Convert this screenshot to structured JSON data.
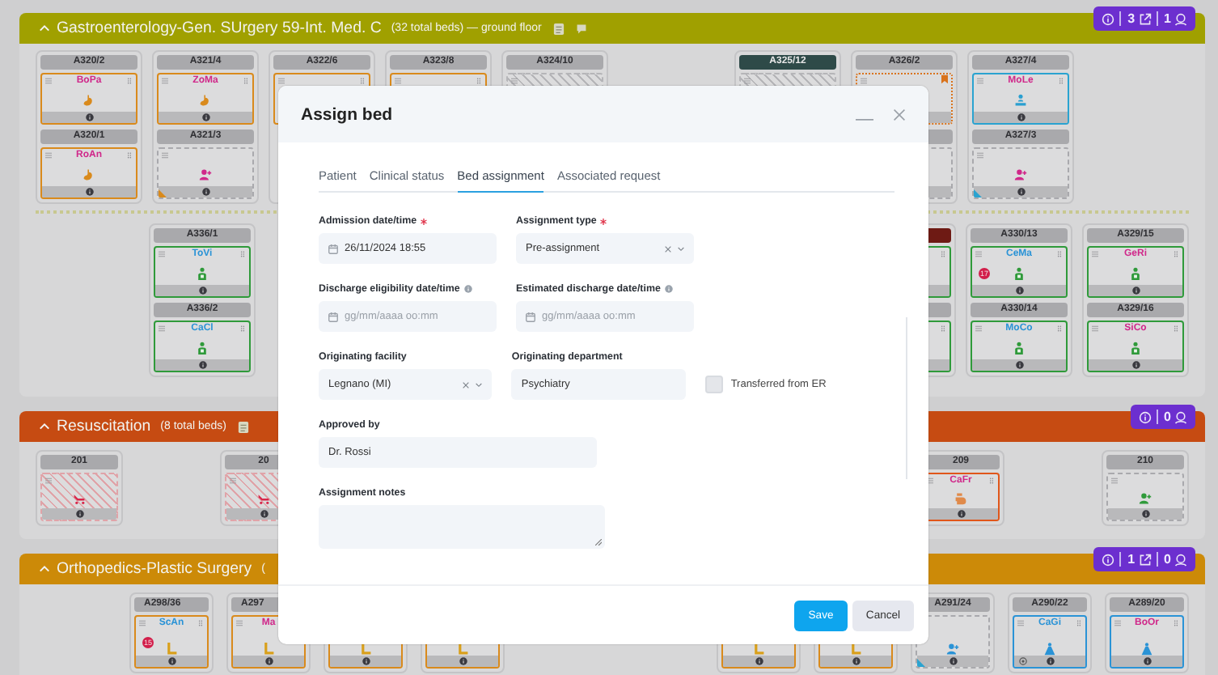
{
  "sections": [
    {
      "kind": "gastro",
      "title": "Gastroenterology-Gen. SUrgery 59-Int. Med. C",
      "subtitle": "(32 total beds) — ground floor",
      "header_icons": [
        {
          "kind": "document"
        },
        {
          "kind": "chat"
        }
      ],
      "counts": [
        {
          "kind": "external",
          "value": "3"
        },
        {
          "kind": "staff",
          "value": "1"
        }
      ],
      "rows": [
        {
          "groups": [
            [
              {
                "beds": [
                  {
                    "label": "A320/2",
                    "kind": "occupied",
                    "color": "#d98a1c",
                    "initials": {
                      "text": "BoPa",
                      "color": "#d0288a"
                    },
                    "icon": {
                      "kind": "stomach",
                      "color": "#d98a1c"
                    }
                  },
                  {
                    "label": "A320/1",
                    "kind": "occupied",
                    "color": "#d98a1c",
                    "initials": {
                      "text": "RoAn",
                      "color": "#d0288a"
                    },
                    "icon": {
                      "kind": "stomach",
                      "color": "#d98a1c"
                    }
                  }
                ]
              },
              {
                "beds": [
                  {
                    "label": "A321/4",
                    "kind": "occupied",
                    "color": "#d98a1c",
                    "initials": {
                      "text": "ZoMa",
                      "color": "#d0288a"
                    },
                    "icon": {
                      "kind": "stomach",
                      "color": "#d98a1c"
                    }
                  },
                  {
                    "label": "A321/3",
                    "kind": "empty",
                    "color": "#a9a9ad",
                    "icon": {
                      "kind": "add-person",
                      "color": "#d0288a"
                    },
                    "corner": {
                      "color": "#d98a1c"
                    }
                  }
                ]
              },
              {
                "beds": [
                  {
                    "label": "A322/6",
                    "kind": "occupied",
                    "color": "#d98a1c"
                  }
                ]
              },
              {
                "beds": [
                  {
                    "label": "A323/8",
                    "kind": "occupied",
                    "color": "#d98a1c"
                  }
                ]
              },
              {
                "beds": [
                  {
                    "label": "A324/10",
                    "kind": "blocked",
                    "color": "#b5b5b8"
                  }
                ]
              }
            ],
            [
              {
                "beds": [
                  {
                    "label": "A325/12",
                    "locked": true,
                    "kind": "blocked",
                    "color": "#b5b5b8"
                  }
                ]
              },
              {
                "beds": [
                  {
                    "label": "A326/2",
                    "kind": "reserved",
                    "color": "#d9731c",
                    "bookmark": true
                  },
                  {
                    "kind": "empty",
                    "color": "#a9a9ad"
                  }
                ]
              },
              {
                "beds": [
                  {
                    "label": "A327/4",
                    "kind": "occupied",
                    "color": "#2aa3d0",
                    "initials": {
                      "text": "MoLe",
                      "color": "#d0288a"
                    },
                    "icon": {
                      "kind": "bed-person",
                      "color": "#2a9fd0"
                    }
                  },
                  {
                    "label": "A327/3",
                    "kind": "empty",
                    "color": "#a9a9ad",
                    "icon": {
                      "kind": "add-person",
                      "color": "#d0288a"
                    },
                    "corner": {
                      "color": "#2aa3d0"
                    }
                  }
                ]
              }
            ]
          ]
        },
        {
          "groups": [
            [
              {
                "beds": [
                  {
                    "label": "A336/1",
                    "kind": "occupied",
                    "color": "#2f9a3a",
                    "initials": {
                      "text": "ToVi",
                      "color": "#2a93d6"
                    },
                    "icon": {
                      "kind": "torso",
                      "color": "#2f9a3a"
                    }
                  },
                  {
                    "label": "A336/2",
                    "kind": "occupied",
                    "color": "#2f9a3a",
                    "initials": {
                      "text": "CaCl",
                      "color": "#2a93d6"
                    },
                    "icon": {
                      "kind": "torso",
                      "color": "#2f9a3a"
                    }
                  }
                ]
              }
            ],
            [
              {
                "beds": [
                  {
                    "alert": true,
                    "kind": "occupied",
                    "color": "#2f9a3a"
                  },
                  {
                    "kind": "occupied",
                    "color": "#2f9a3a"
                  }
                ]
              },
              {
                "beds": [
                  {
                    "label": "A330/13",
                    "kind": "occupied",
                    "color": "#2f9a3a",
                    "initials": {
                      "text": "CeMa",
                      "color": "#2a93d6"
                    },
                    "icon": {
                      "kind": "torso",
                      "color": "#2f9a3a"
                    },
                    "badge": "17"
                  },
                  {
                    "label": "A330/14",
                    "kind": "occupied",
                    "color": "#2f9a3a",
                    "initials": {
                      "text": "MoCo",
                      "color": "#2a93d6"
                    },
                    "icon": {
                      "kind": "torso",
                      "color": "#2f9a3a"
                    }
                  }
                ]
              },
              {
                "beds": [
                  {
                    "label": "A329/15",
                    "kind": "occupied",
                    "color": "#2f9a3a",
                    "initials": {
                      "text": "GeRi",
                      "color": "#d0288a"
                    },
                    "icon": {
                      "kind": "torso",
                      "color": "#2f9a3a"
                    }
                  },
                  {
                    "label": "A329/16",
                    "kind": "occupied",
                    "color": "#2f9a3a",
                    "initials": {
                      "text": "SiCo",
                      "color": "#d0288a"
                    },
                    "icon": {
                      "kind": "torso",
                      "color": "#2f9a3a"
                    }
                  }
                ]
              }
            ]
          ]
        }
      ]
    },
    {
      "kind": "resuscitation",
      "title": "Resuscitation",
      "subtitle": "(8 total beds)",
      "header_icons": [
        {
          "kind": "document"
        }
      ],
      "counts": [
        {
          "kind": "staff",
          "value": "0"
        }
      ],
      "rows": [
        {
          "groups": [
            [
              {
                "beds": [
                  {
                    "label": "201",
                    "kind": "blocked",
                    "color": "#e0a3a8",
                    "icon": {
                      "kind": "stretcher",
                      "color": "#d8264a"
                    }
                  }
                ]
              },
              {
                "beds": [
                  {
                    "label": "20",
                    "kind": "blocked",
                    "color": "#e0a3a8",
                    "icon": {
                      "kind": "stretcher",
                      "color": "#d8264a"
                    }
                  }
                ]
              }
            ],
            [
              {
                "beds": [
                  {
                    "label": "209",
                    "kind": "occupied",
                    "color": "#e0561a",
                    "initials": {
                      "text": "CaFr",
                      "color": "#d0288a"
                    },
                    "icon": {
                      "kind": "hand",
                      "color": "#e08a4a"
                    }
                  }
                ]
              },
              {
                "beds": [
                  {
                    "label": "210",
                    "kind": "empty",
                    "color": "#a9a9ad",
                    "icon": {
                      "kind": "add-person",
                      "color": "#2f9a3a"
                    }
                  }
                ]
              }
            ]
          ]
        }
      ]
    },
    {
      "kind": "orthopedics",
      "title": "Orthopedics-Plastic Surgery",
      "subtitle": "(",
      "counts": [
        {
          "kind": "external",
          "value": "1"
        },
        {
          "kind": "staff",
          "value": "0"
        }
      ],
      "rows": [
        {
          "groups": [
            [
              {
                "beds": [
                  {
                    "label": "A298/36",
                    "kind": "occupied",
                    "color": "#d98a1c",
                    "initials": {
                      "text": "ScAn",
                      "color": "#2a93d6"
                    },
                    "icon": {
                      "kind": "leg",
                      "color": "#d9a01c"
                    },
                    "badge": "15"
                  }
                ]
              },
              {
                "beds": [
                  {
                    "label": "A297",
                    "kind": "occupied",
                    "color": "#d98a1c",
                    "initials": {
                      "text": "Ma",
                      "color": "#d0288a"
                    },
                    "icon": {
                      "kind": "leg",
                      "color": "#d9a01c"
                    }
                  }
                ]
              },
              {
                "beds": [
                  {
                    "kind": "occupied",
                    "color": "#d98a1c",
                    "icon": {
                      "kind": "leg",
                      "color": "#d9a01c"
                    }
                  }
                ]
              },
              {
                "beds": [
                  {
                    "kind": "occupied",
                    "color": "#d98a1c",
                    "icon": {
                      "kind": "leg",
                      "color": "#d9a01c"
                    }
                  }
                ]
              }
            ],
            [
              {
                "beds": [
                  {
                    "kind": "occupied",
                    "color": "#d98a1c",
                    "icon": {
                      "kind": "leg",
                      "color": "#d9a01c"
                    }
                  }
                ]
              },
              {
                "beds": [
                  {
                    "kind": "occupied",
                    "color": "#d98a1c",
                    "icon": {
                      "kind": "leg",
                      "color": "#d9a01c"
                    }
                  }
                ]
              },
              {
                "beds": [
                  {
                    "label": "A291/24",
                    "kind": "empty",
                    "color": "#a9a9ad",
                    "icon": {
                      "kind": "add-person",
                      "color": "#2a93d6"
                    },
                    "corner": {
                      "color": "#2aa3d0"
                    }
                  }
                ]
              },
              {
                "beds": [
                  {
                    "label": "A290/22",
                    "kind": "occupied",
                    "color": "#2a93d6",
                    "initials": {
                      "text": "CaGi",
                      "color": "#2a93d6"
                    },
                    "icon": {
                      "kind": "cone",
                      "color": "#2a93d6"
                    },
                    "gender": true
                  }
                ]
              },
              {
                "beds": [
                  {
                    "label": "A289/20",
                    "kind": "occupied",
                    "color": "#2a93d6",
                    "initials": {
                      "text": "BoOr",
                      "color": "#d0288a"
                    },
                    "icon": {
                      "kind": "cone",
                      "color": "#2a93d6"
                    }
                  }
                ]
              }
            ]
          ]
        }
      ]
    }
  ],
  "modal": {
    "title": "Assign bed",
    "tabs": [
      {
        "label": "Patient",
        "selected": false
      },
      {
        "label": "Clinical status",
        "selected": false
      },
      {
        "label": "Bed assignment",
        "selected": true
      },
      {
        "label": "Associated request",
        "selected": false
      }
    ],
    "rows": [
      [
        {
          "kind": "date",
          "label": "Admission date/time",
          "required": true,
          "value": "26/11/2024 18:55"
        },
        {
          "kind": "select",
          "label": "Assignment type",
          "required": true,
          "value": "Pre-assignment"
        }
      ],
      [
        {
          "kind": "date",
          "label": "Discharge eligibility date/time",
          "info": true,
          "placeholder": "gg/mm/aaaa oo:mm"
        },
        {
          "kind": "date",
          "label": "Estimated discharge date/time",
          "info": true,
          "placeholder": "gg/mm/aaaa oo:mm"
        }
      ],
      [
        {
          "kind": "select",
          "label": "Originating facility",
          "value": "Legnano (MI)"
        },
        {
          "kind": "text",
          "label": "Originating department",
          "value": "Psychiatry"
        },
        {
          "kind": "checkbox",
          "label": "Transferred from ER",
          "checked": false
        }
      ],
      [
        {
          "kind": "text",
          "label": "Approved by",
          "value": "Dr. Rossi"
        }
      ],
      [
        {
          "kind": "textarea",
          "label": "Assignment notes"
        }
      ]
    ],
    "buttons": [
      {
        "kind": "primary",
        "label": "Save"
      },
      {
        "kind": "secondary",
        "label": "Cancel"
      }
    ]
  }
}
